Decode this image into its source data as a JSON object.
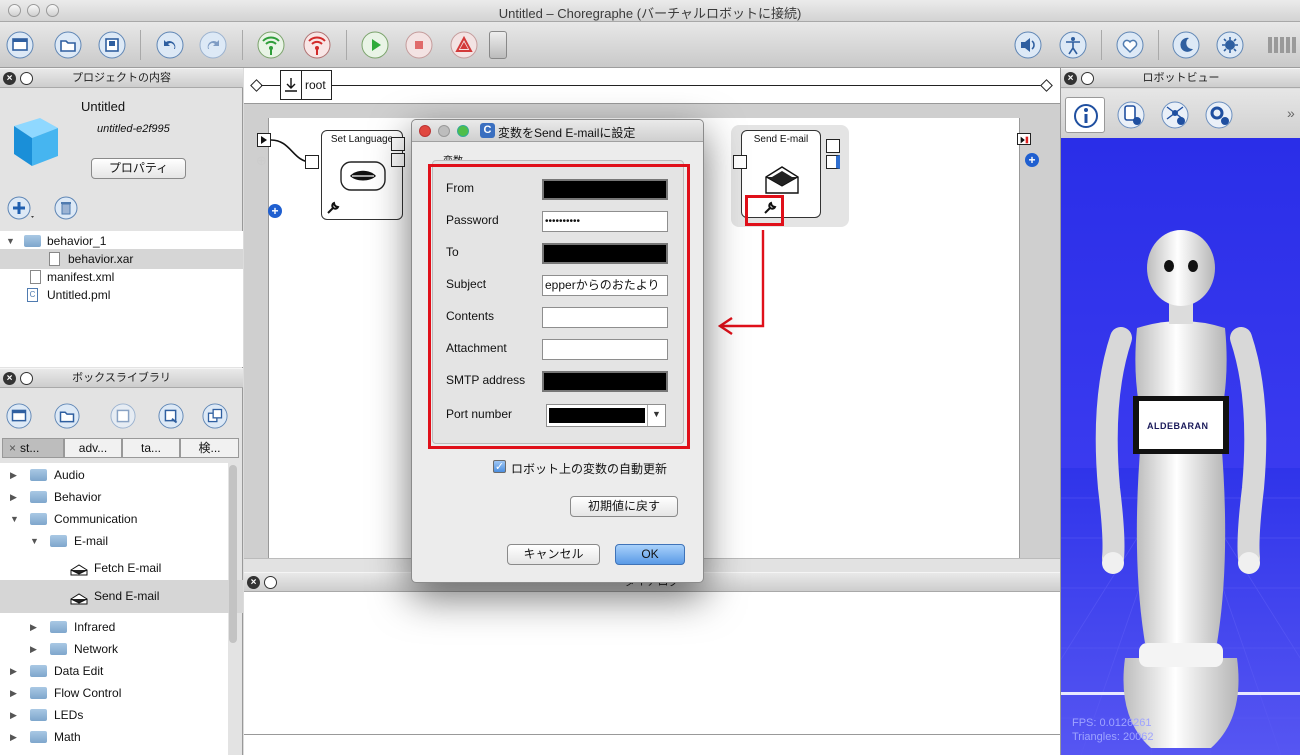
{
  "window": {
    "title": "Untitled – Choregraphe (バーチャルロボットに接続)"
  },
  "project_panel": {
    "title": "プロジェクトの内容",
    "project_name": "Untitled",
    "project_id": "untitled-e2f995",
    "properties_button": "プロパティ",
    "files": [
      {
        "label": "behavior_1",
        "type": "folder"
      },
      {
        "label": "behavior.xar",
        "type": "file"
      },
      {
        "label": "manifest.xml",
        "type": "file"
      },
      {
        "label": "Untitled.pml",
        "type": "pml"
      }
    ]
  },
  "box_library": {
    "title": "ボックスライブラリ",
    "tabs": [
      "st...",
      "adv...",
      "ta...",
      "検..."
    ],
    "items": [
      {
        "label": "Audio"
      },
      {
        "label": "Behavior"
      },
      {
        "label": "Communication"
      },
      {
        "label": "E-mail"
      },
      {
        "label": "Fetch E-mail"
      },
      {
        "label": "Send E-mail"
      },
      {
        "label": "Infrared"
      },
      {
        "label": "Network"
      },
      {
        "label": "Data Edit"
      },
      {
        "label": "Flow Control"
      },
      {
        "label": "LEDs"
      },
      {
        "label": "Math"
      }
    ]
  },
  "canvas": {
    "breadcrumb": "root",
    "boxes": {
      "set_language": "Set Language",
      "send_email": "Send E-mail"
    },
    "lower_panel_title": "ダイアログ"
  },
  "robot_view": {
    "title": "ロボットビュー",
    "logo_text": "ALDEBARAN",
    "fps": "FPS: 0.0126261",
    "triangles": "Triangles: 20062"
  },
  "dialog": {
    "title": "変数をSend E-mailに設定",
    "group_label": "変数",
    "fields": [
      {
        "label": "From",
        "value": "",
        "redacted": true
      },
      {
        "label": "Password",
        "value": "••••••••••",
        "redacted": false
      },
      {
        "label": "To",
        "value": "",
        "redacted": true
      },
      {
        "label": "Subject",
        "value": "epperからのおたより",
        "redacted": false
      },
      {
        "label": "Contents",
        "value": "",
        "redacted": false
      },
      {
        "label": "Attachment",
        "value": "",
        "redacted": false
      },
      {
        "label": "SMTP address",
        "value": "",
        "redacted": true
      },
      {
        "label": "Port number",
        "value": "",
        "redacted": true
      }
    ],
    "auto_update_label": "ロボット上の変数の自動更新",
    "reset_button": "初期値に戻す",
    "cancel_button": "キャンセル",
    "ok_button": "OK"
  },
  "colors": {
    "highlight_red": "#e0101a",
    "robot_bg": "#3434ee",
    "ok_blue": "#6aa9ea"
  }
}
